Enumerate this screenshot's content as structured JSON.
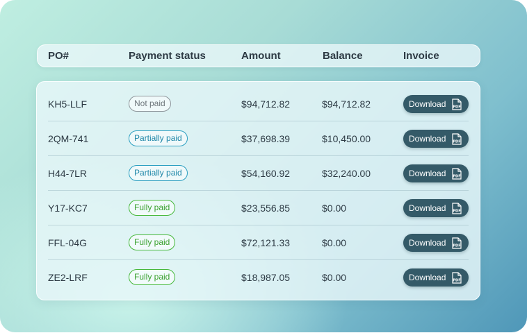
{
  "header": {
    "po": "PO#",
    "status": "Payment status",
    "amount": "Amount",
    "balance": "Balance",
    "invoice": "Invoice"
  },
  "rows": [
    {
      "po": "KH5-LLF",
      "status": "Not paid",
      "amount": "$94,712.82",
      "balance": "$94,712.82",
      "download": "Download"
    },
    {
      "po": "2QM-741",
      "status": "Partially paid",
      "amount": "$37,698.39",
      "balance": "$10,450.00",
      "download": "Download"
    },
    {
      "po": "H44-7LR",
      "status": "Partially paid",
      "amount": "$54,160.92",
      "balance": "$32,240.00",
      "download": "Download"
    },
    {
      "po": "Y17-KC7",
      "status": "Fully paid",
      "amount": "$23,556.85",
      "balance": "$0.00",
      "download": "Download"
    },
    {
      "po": "FFL-04G",
      "status": "Fully paid",
      "amount": "$72,121.33",
      "balance": "$0.00",
      "download": "Download"
    },
    {
      "po": "ZE2-LRF",
      "status": "Fully paid",
      "amount": "$18,987.05",
      "balance": "$0.00",
      "download": "Download"
    }
  ],
  "icons": {
    "pdf": "pdf-file-icon",
    "pdf_text": "PDF"
  },
  "colors": {
    "not_paid": "#8e969b",
    "partially_paid": "#2c9fc1",
    "fully_paid": "#46b83a",
    "download_button": "#345a68"
  }
}
